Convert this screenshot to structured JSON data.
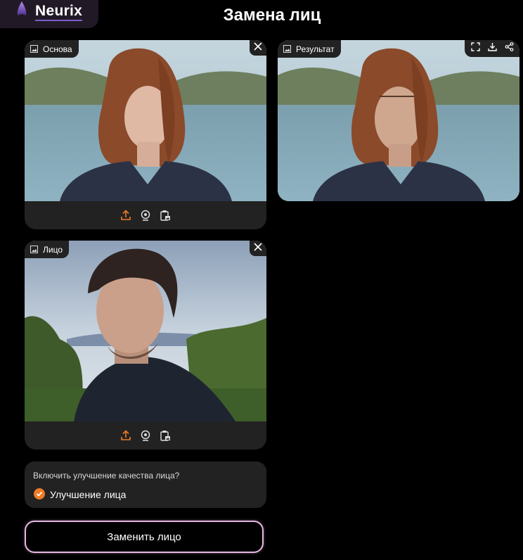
{
  "brand": {
    "name": "Neurix"
  },
  "page": {
    "title": "Замена лиц"
  },
  "cards": {
    "base": {
      "label": "Основа"
    },
    "result": {
      "label": "Результат"
    },
    "face": {
      "label": "Лицо"
    }
  },
  "icons": {
    "image": "image-icon",
    "close": "close-icon",
    "fullscreen": "fullscreen-icon",
    "download": "download-icon",
    "share": "share-icon",
    "upload": "upload-icon",
    "webcam": "webcam-icon",
    "paste": "clipboard-image-icon"
  },
  "enhancement": {
    "question": "Включить улучшение качества лица?",
    "option_label": "Улучшение лица",
    "checked": true
  },
  "actions": {
    "swap_label": "Заменить лицо"
  },
  "colors": {
    "accent": "#f07b25",
    "button_border": "#e7b6e3",
    "panel": "#222222",
    "brand_purple": "#7c5cc8"
  }
}
